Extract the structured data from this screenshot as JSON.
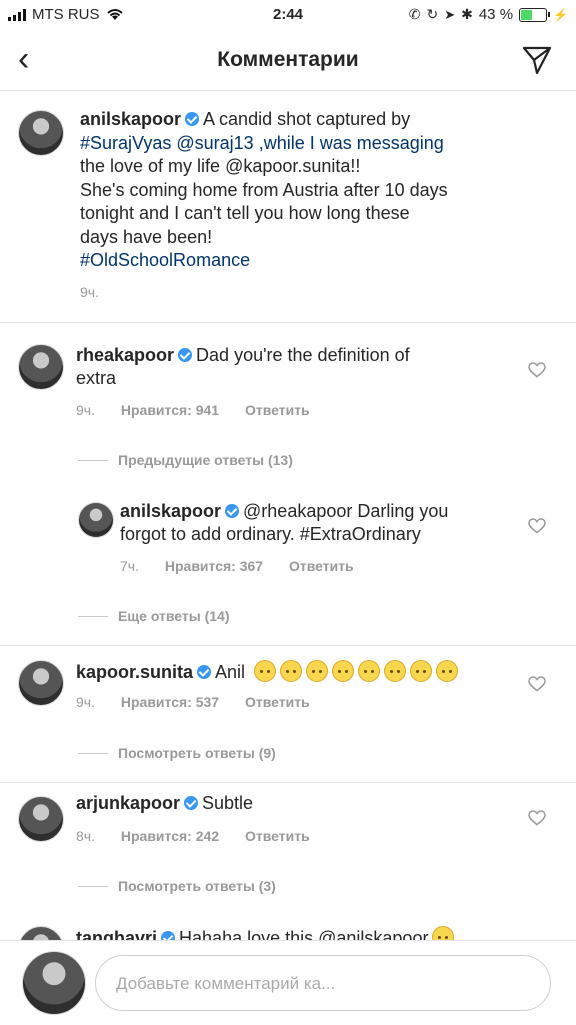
{
  "status": {
    "carrier": "MTS RUS",
    "time": "2:44",
    "battery": "43 %"
  },
  "nav": {
    "title": "Комментарии"
  },
  "caption": {
    "user": "anilskapoor",
    "line1": "A candid shot captured by",
    "line2": "#SurajVyas @suraj13 ,while I was messaging",
    "line3": "the love of my life @kapoor.sunita!!",
    "line4": "She's coming home from Austria after 10 days",
    "line5": "tonight and I can't tell you how long these",
    "line6": "days have been!",
    "line7": "#OldSchoolRomance",
    "time": "9ч."
  },
  "comments": [
    {
      "user": "rheakapoor",
      "text1": "Dad you're the definition of",
      "text2": "extra",
      "time": "9ч.",
      "likes": "Нравится: 941",
      "reply": "Ответить",
      "more": "Предыдущие ответы (13)"
    },
    {
      "user": "anilskapoor",
      "text1": "@rheakapoor Darling you",
      "text2": "forgot to add ordinary. #ExtraOrdinary",
      "time": "7ч.",
      "likes": "Нравится: 367",
      "reply": "Ответить",
      "more": "Еще ответы (14)"
    },
    {
      "user": "kapoor.sunita",
      "text1": "Anil",
      "time": "9ч.",
      "likes": "Нравится: 537",
      "reply": "Ответить",
      "more": "Посмотреть ответы (9)"
    },
    {
      "user": "arjunkapoor",
      "text1": "Subtle",
      "time": "8ч.",
      "likes": "Нравится: 242",
      "reply": "Ответить",
      "more": "Посмотреть ответы (3)"
    },
    {
      "user": "tanghavri",
      "text1": "Hahaha love this @anilskapoor"
    }
  ],
  "input": {
    "placeholder": "Добавьте комментарий ка..."
  }
}
